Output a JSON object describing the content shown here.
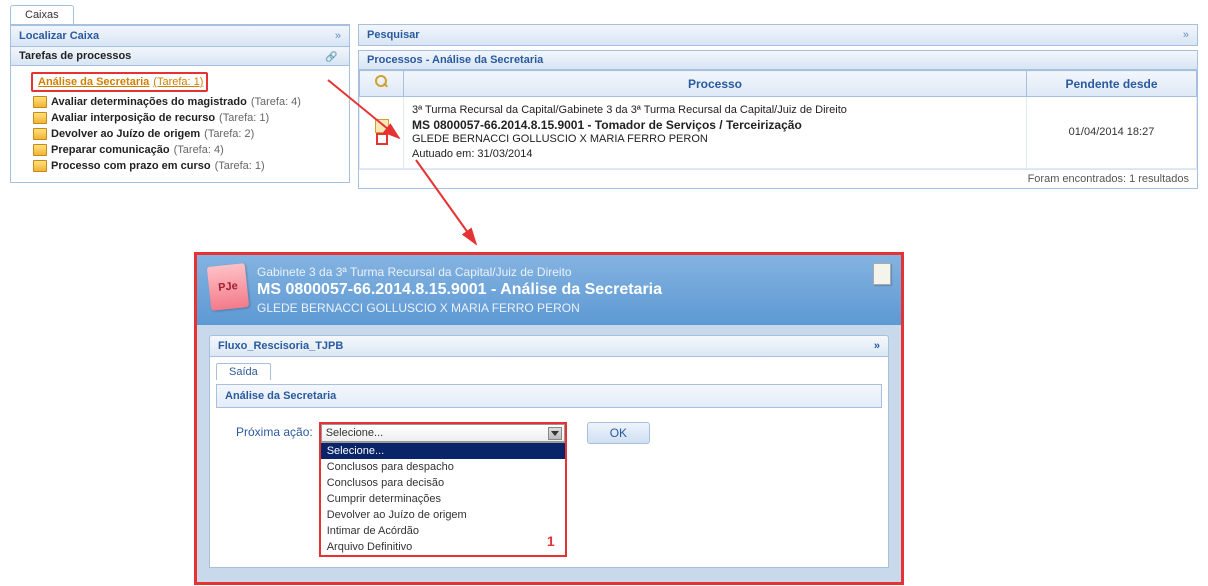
{
  "tabs": {
    "main": "Caixas"
  },
  "sidebar": {
    "locate_header": "Localizar Caixa",
    "tasks_header": "Tarefas de processos",
    "items": [
      {
        "label": "Análise da Secretaria",
        "count": "(Tarefa: 1)"
      },
      {
        "label": "Avaliar determinações do magistrado",
        "count": "(Tarefa: 4)"
      },
      {
        "label": "Avaliar interposição de recurso",
        "count": "(Tarefa: 1)"
      },
      {
        "label": "Devolver ao Juízo de origem",
        "count": "(Tarefa: 2)"
      },
      {
        "label": "Preparar comunicação",
        "count": "(Tarefa: 4)"
      },
      {
        "label": "Processo com prazo em curso",
        "count": "(Tarefa: 1)"
      }
    ]
  },
  "search": {
    "header": "Pesquisar",
    "subheader": "Processos - Análise da Secretaria",
    "columns": {
      "process": "Processo",
      "pending": "Pendente desde"
    },
    "row": {
      "line1": "3ª Turma Recursal da Capital/Gabinete 3 da 3ª Turma Recursal da Capital/Juiz de Direito",
      "title": "MS 0800057-66.2014.8.15.9001 - Tomador de Serviços / Terceirização",
      "line3": "GLEDE BERNACCI GOLLUSCIO X MARIA FERRO PERON",
      "line4": "Autuado em: 31/03/2014",
      "date": "01/04/2014 18:27"
    },
    "footer": "Foram encontrados: 1 resultados"
  },
  "popup": {
    "badge": "PJe",
    "line1": "Gabinete 3 da 3ª Turma Recursal da Capital/Juiz de Direito",
    "line2": "MS 0800057-66.2014.8.15.9001 - Análise da Secretaria",
    "line3": "GLEDE BERNACCI GOLLUSCIO X MARIA FERRO PERON",
    "flow_header": "Fluxo_Rescisoria_TJPB",
    "tab": "Saída",
    "task_bar": "Análise da Secretaria",
    "action_label": "Próxima ação:",
    "select_value": "Selecione...",
    "options": [
      "Selecione...",
      "Conclusos para despacho",
      "Conclusos para decisão",
      "Cumprir determinações",
      "Devolver ao Juízo de origem",
      "Intimar de Acórdão",
      "Arquivo Definitivo"
    ],
    "ok_label": "OK",
    "annotation": "1"
  }
}
